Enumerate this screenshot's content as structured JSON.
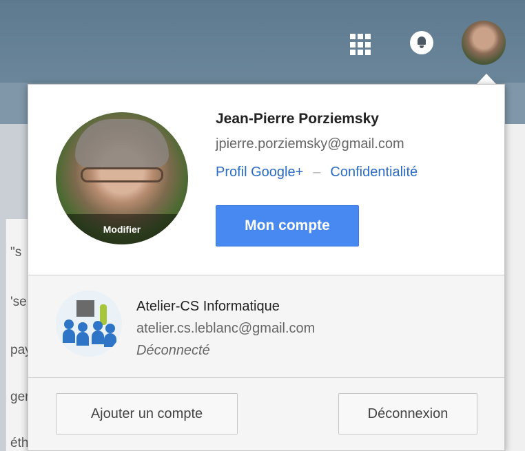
{
  "background": {
    "left_fragments": [
      "\"s",
      "'se",
      "pay",
      "ger",
      "éthr"
    ]
  },
  "header": {
    "apps_icon": "apps-grid-icon",
    "notifications_icon": "bell-icon"
  },
  "account_popup": {
    "primary": {
      "name": "Jean-Pierre Porziemsky",
      "email": "jpierre.porziemsky@gmail.com",
      "avatar_overlay_label": "Modifier",
      "profile_link": "Profil Google+",
      "link_separator": "–",
      "privacy_link": "Confidentialité",
      "account_button": "Mon compte"
    },
    "secondary": {
      "name": "Atelier-CS Informatique",
      "email": "atelier.cs.leblanc@gmail.com",
      "status": "Déconnecté"
    },
    "footer": {
      "add_account_button": "Ajouter un compte",
      "logout_button": "Déconnexion"
    }
  },
  "colors": {
    "header_bg": "#6b869a",
    "primary_button": "#4889f1",
    "link": "#2a6bc4"
  }
}
